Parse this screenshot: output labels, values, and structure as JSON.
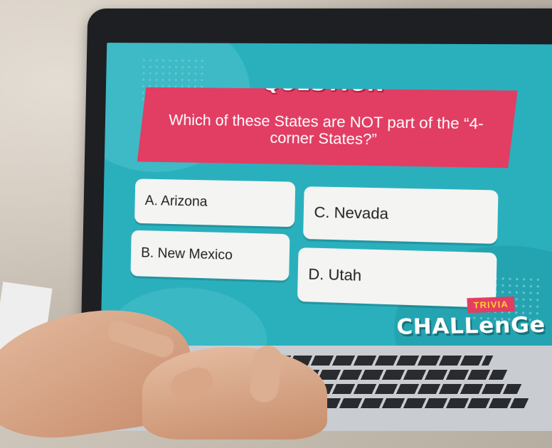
{
  "question": {
    "heading": "QUESTION",
    "text": "Which of these States are NOT part of the “4-corner States?”"
  },
  "answers": [
    {
      "id": "A",
      "label": "A. Arizona"
    },
    {
      "id": "B",
      "label": "B. New Mexico"
    },
    {
      "id": "C",
      "label": "C. Nevada"
    },
    {
      "id": "D",
      "label": "D. Utah"
    }
  ],
  "logo": {
    "tag": "TRIVIA",
    "word": "CHALLenGe"
  },
  "colors": {
    "screen_background": "#2ab0bd",
    "banner": "#e23d63",
    "answer_card": "#f4f4f3",
    "logo_tag_text": "#ffd22e"
  }
}
